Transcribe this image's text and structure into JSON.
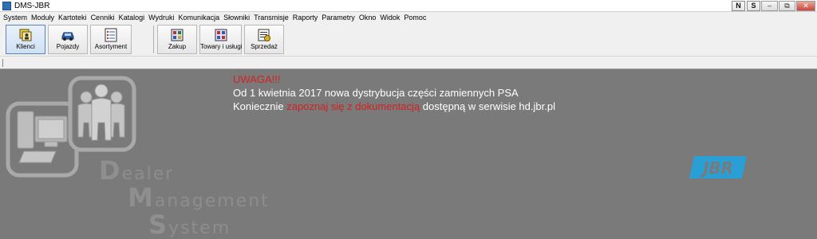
{
  "window": {
    "title": "DMS-JBR",
    "btn_n": "N",
    "btn_s": "S",
    "minimize": "‒",
    "restore": "⧉",
    "close": "✕"
  },
  "menu": [
    "System",
    "Moduły",
    "Kartoteki",
    "Cenniki",
    "Katalogi",
    "Wydruki",
    "Komunikacja",
    "Słowniki",
    "Transmisje",
    "Raporty",
    "Parametry",
    "Okno",
    "Widok",
    "Pomoc"
  ],
  "toolbar": {
    "klienci": "Klienci",
    "pojazdy": "Pojazdy",
    "asortyment": "Asortyment",
    "zakup": "Zakup",
    "towary": "Towary i usługi",
    "sprzedaz": "Sprzedaż"
  },
  "notice": {
    "warning": "UWAGA!!!",
    "line1": "Od 1 kwietnia 2017 nowa dystrybucja części zamiennych PSA",
    "line2_prefix": "Koniecznie ",
    "line2_link": "zapoznaj się z dokumentacją",
    "line2_suffix": " dostępną w serwisie hd.jbr.pl"
  },
  "branding": {
    "w1_initial": "D",
    "w1_rest": "ealer",
    "w2_initial": "M",
    "w2_rest": "anagement",
    "w3_initial": "S",
    "w3_rest": "ystem",
    "logo": "JBR"
  },
  "colors": {
    "workspace": "#7a7a7a",
    "warning": "#d42020",
    "logo_blue": "#2a9fd6"
  }
}
